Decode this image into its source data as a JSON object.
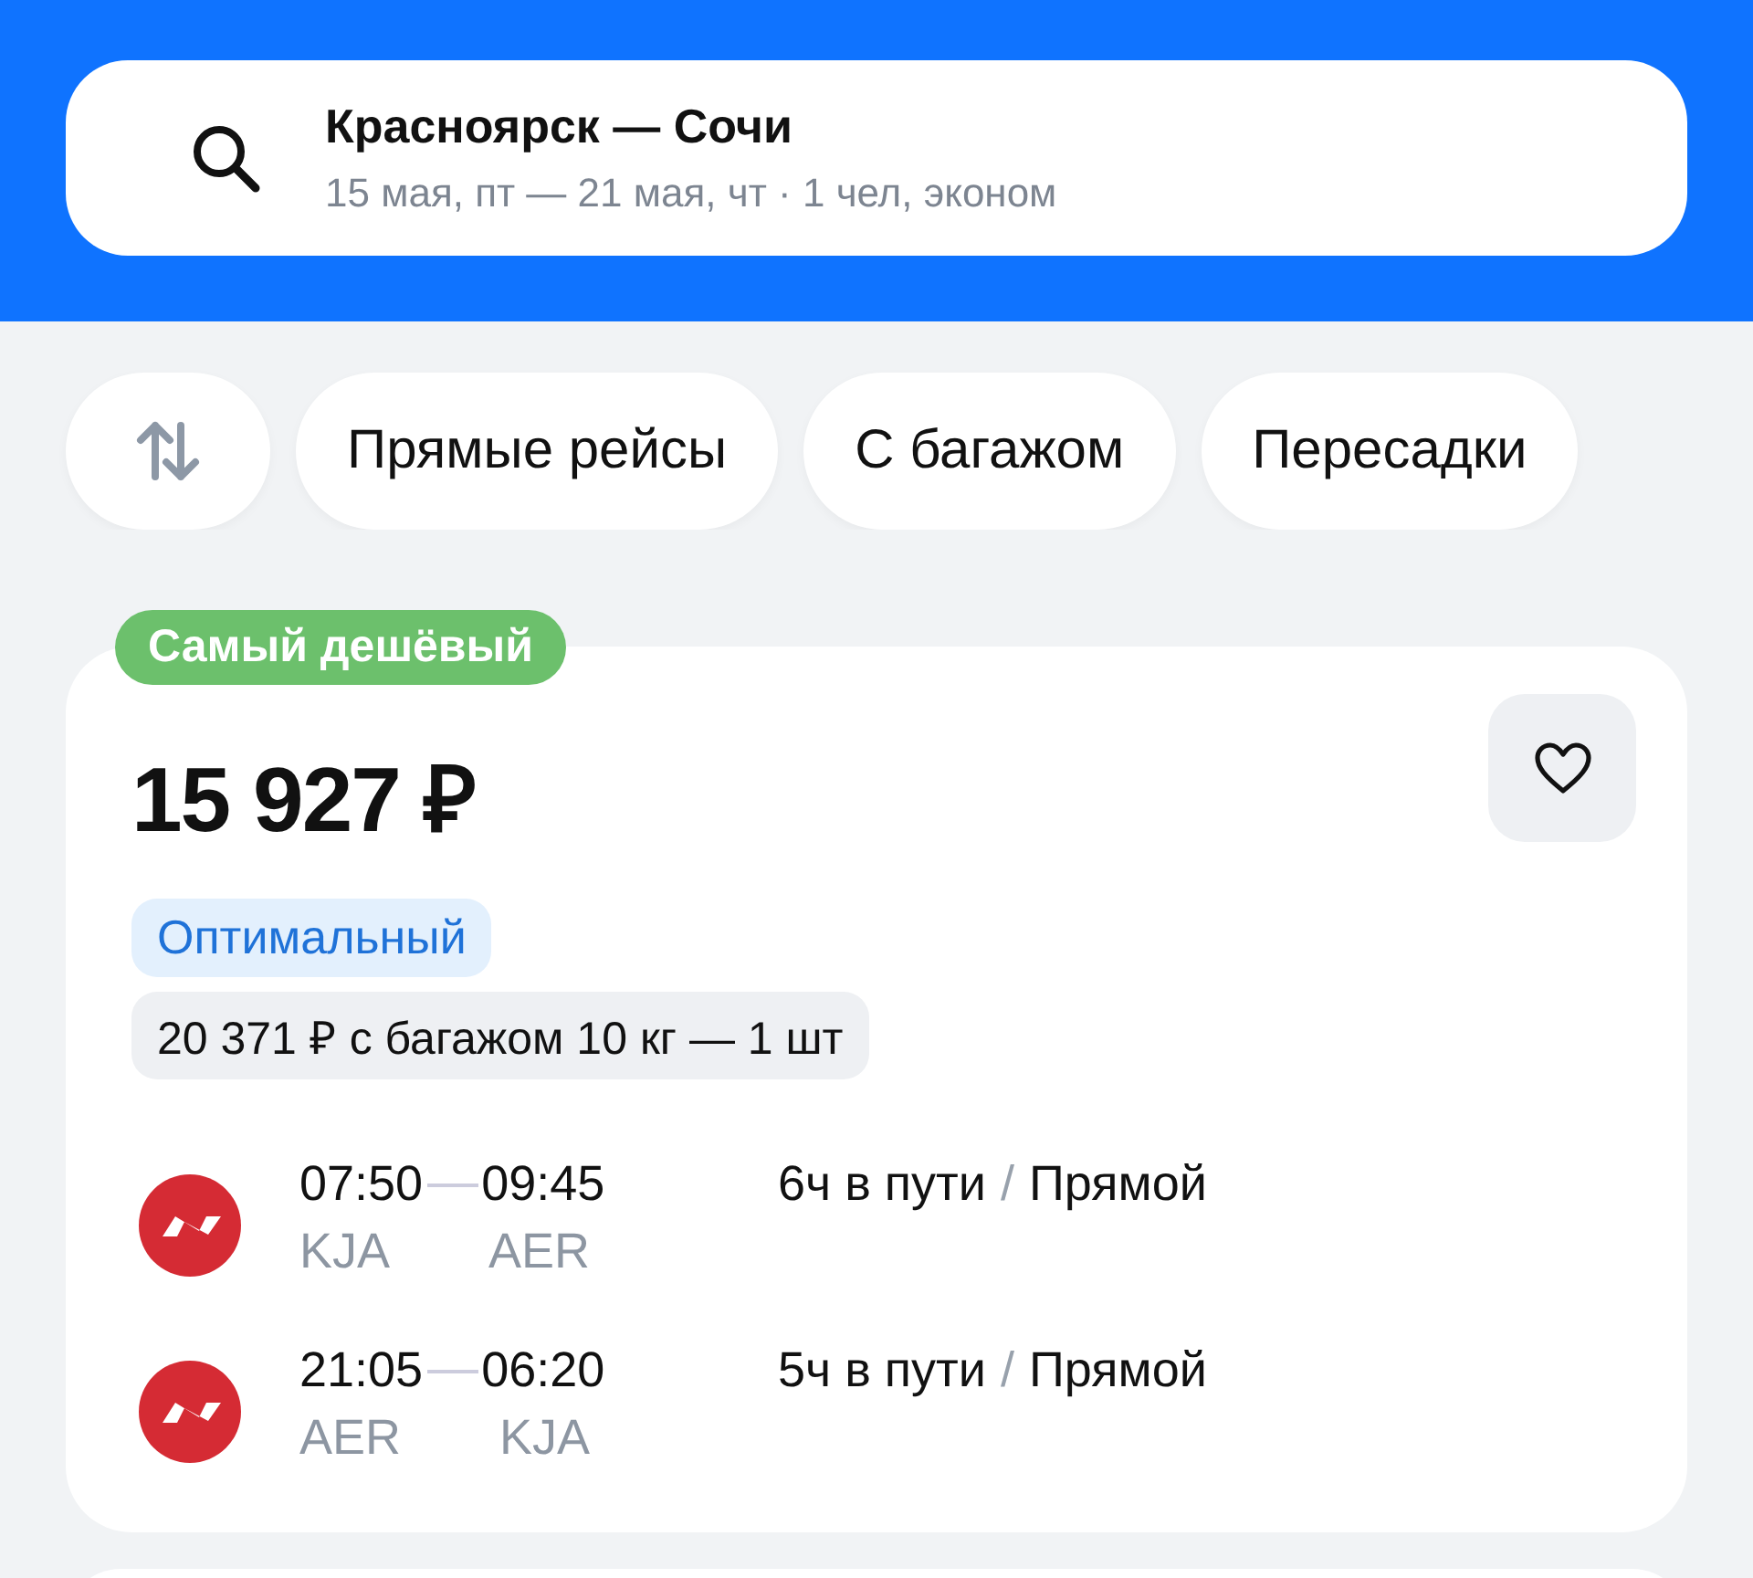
{
  "search": {
    "route": "Красноярск — Сочи",
    "details": "15 мая, пт — 21 мая, чт · 1 чел, эконом"
  },
  "filters": [
    {
      "label": "Прямые рейсы",
      "selected": false
    },
    {
      "label": "С багажом",
      "selected": false
    },
    {
      "label": "Пересадки",
      "selected": false
    }
  ],
  "offer": {
    "badge": "Самый дешёвый",
    "price": "15 927 ₽",
    "favorite": false,
    "tag": "Оптимальный",
    "baggage_price": "20 371 ₽ с багажом 10 кг — 1 шт",
    "flights": [
      {
        "depart_time": "07:50",
        "arrive_time": "09:45",
        "from": "KJA",
        "to": "AER",
        "duration": "6ч в пути",
        "separator": "/",
        "type": "Прямой"
      },
      {
        "depart_time": "21:05",
        "arrive_time": "06:20",
        "from": "AER",
        "to": "KJA",
        "duration": "5ч в пути",
        "separator": "/",
        "type": "Прямой"
      }
    ]
  }
}
